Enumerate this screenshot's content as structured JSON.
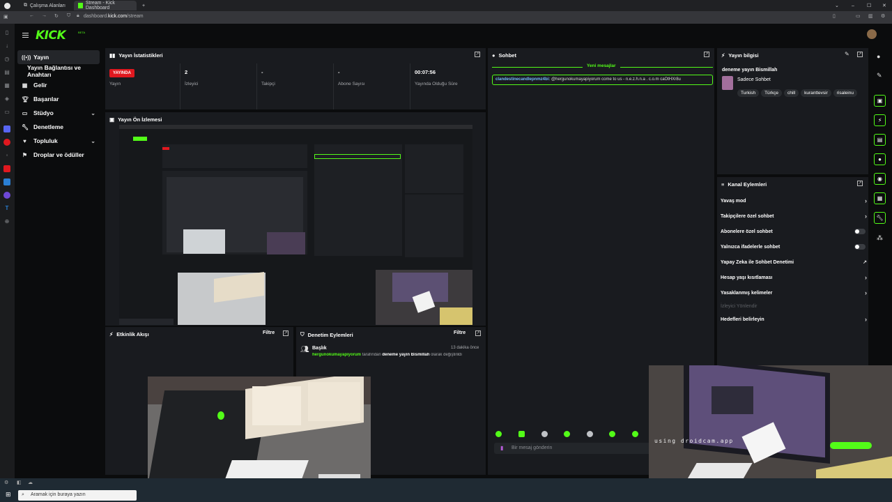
{
  "browser": {
    "tabs": [
      {
        "label": "Çalışma Alanları"
      },
      {
        "label": "Stream - Kick Dashboard"
      }
    ],
    "url_prefix": "dashboard.",
    "url_domain": "kick.com",
    "url_path": "/stream"
  },
  "kick": {
    "logo": "KICK",
    "logo_badge": "BETA",
    "accent": "#53fc18"
  },
  "nav": {
    "items": [
      {
        "label": "Yayın",
        "icon": "broadcast-icon"
      },
      {
        "label": "Yayın Bağlantısı ve Anahtarı",
        "icon": ""
      },
      {
        "label": "Gelir",
        "icon": "revenue-icon"
      },
      {
        "label": "Başarılar",
        "icon": "trophy-icon"
      },
      {
        "label": "Stüdyo",
        "icon": "studio-icon"
      },
      {
        "label": "Denetleme",
        "icon": "wrench-icon"
      },
      {
        "label": "Topluluk",
        "icon": "community-icon"
      },
      {
        "label": "Droplar ve ödüller",
        "icon": "gift-icon"
      }
    ]
  },
  "stats": {
    "title": "Yayın İstatistikleri",
    "live_badge": "YAYINDA",
    "cells": [
      {
        "value": "",
        "label": "Yayın"
      },
      {
        "value": "2",
        "label": "İzleyici"
      },
      {
        "value": "-",
        "label": "Takipçi"
      },
      {
        "value": "-",
        "label": "Abone Sayısı"
      },
      {
        "value": "00:07:56",
        "label": "Yayında Olduğu Süre"
      }
    ]
  },
  "preview": {
    "title": "Yayın Ön İzlemesi"
  },
  "activity": {
    "title": "Etkinlik Akışı",
    "filter": "Filtre"
  },
  "moderation": {
    "title": "Denetim Eylemleri",
    "filter": "Filtre",
    "entry_title": "Başlık",
    "entry_time": "13 dakika önce",
    "entry_user": "hergunokumayapiyorum",
    "entry_mid": "tarafından",
    "entry_value": "deneme yayın Bismillah",
    "entry_end": "olarak değiştirildi"
  },
  "chat": {
    "title": "Sohbet",
    "new_messages": "Yeni mesajlar",
    "message_user": "clandestinecandlepnmz4bi:",
    "message_text": "@hergunokumayapiyorum come to us - n.e.z.h.n.a . c.o.m caOtHXr8u",
    "input_placeholder": "Bir mesaj gönderin"
  },
  "stream_info": {
    "title": "Yayın bilgisi",
    "stream_title": "deneme yayın Bismillah",
    "category": "Sadece Sohbet",
    "tags": [
      "Turkish",
      "Türkçe",
      "chill",
      "kuranttevsir",
      "risaleinu"
    ]
  },
  "channel_actions": {
    "title": "Kanal Eylemleri",
    "rows": [
      {
        "label": "Yavaş mod",
        "control": "chevron"
      },
      {
        "label": "Takipçilere özel sohbet",
        "control": "chevron"
      },
      {
        "label": "Abonelere özel sohbet",
        "control": "toggle"
      },
      {
        "label": "Yalnızca ifadelerle sohbet",
        "control": "toggle"
      },
      {
        "label": "Yapay Zeka ile Sohbet Denetimi",
        "control": "external"
      },
      {
        "label": "Hesap yaşı kısıtlaması",
        "control": "chevron"
      },
      {
        "label": "Yasaklanmış kelimeler",
        "control": "chevron"
      },
      {
        "label": "İzleyici Yönlendir",
        "control": "disabled"
      },
      {
        "label": "Hedefleri belirleyin",
        "control": "chevron"
      }
    ]
  },
  "webcam_text": "using droidcam.app",
  "taskbar": {
    "search_placeholder": "Aramak için buraya yazın"
  }
}
